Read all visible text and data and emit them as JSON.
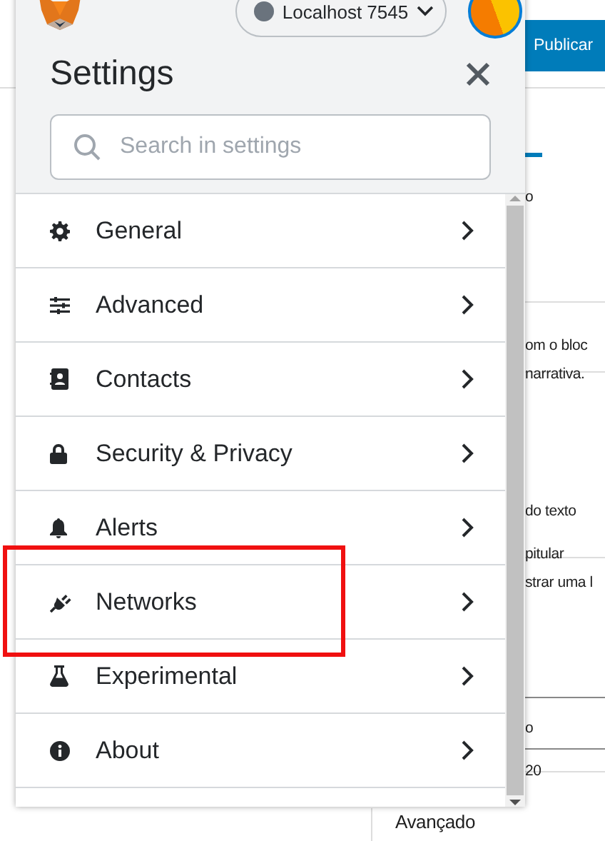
{
  "page": {
    "publish_button": "Publicar",
    "fragments": [
      {
        "text": "o"
      },
      {
        "text": "om o bloc"
      },
      {
        "text": "narrativa."
      },
      {
        "text": "do texto"
      },
      {
        "text": "pitular"
      },
      {
        "text": "strar uma l"
      },
      {
        "text": "o"
      },
      {
        "text": "20"
      }
    ],
    "footer_text": "Avançado"
  },
  "popup": {
    "network": "Localhost 7545",
    "title": "Settings",
    "search": {
      "placeholder": "Search in settings"
    },
    "items": [
      {
        "label": "General",
        "highlighted": false
      },
      {
        "label": "Advanced",
        "highlighted": false
      },
      {
        "label": "Contacts",
        "highlighted": false
      },
      {
        "label": "Security & Privacy",
        "highlighted": false
      },
      {
        "label": "Alerts",
        "highlighted": false
      },
      {
        "label": "Networks",
        "highlighted": true
      },
      {
        "label": "Experimental",
        "highlighted": false
      },
      {
        "label": "About",
        "highlighted": false
      }
    ]
  }
}
